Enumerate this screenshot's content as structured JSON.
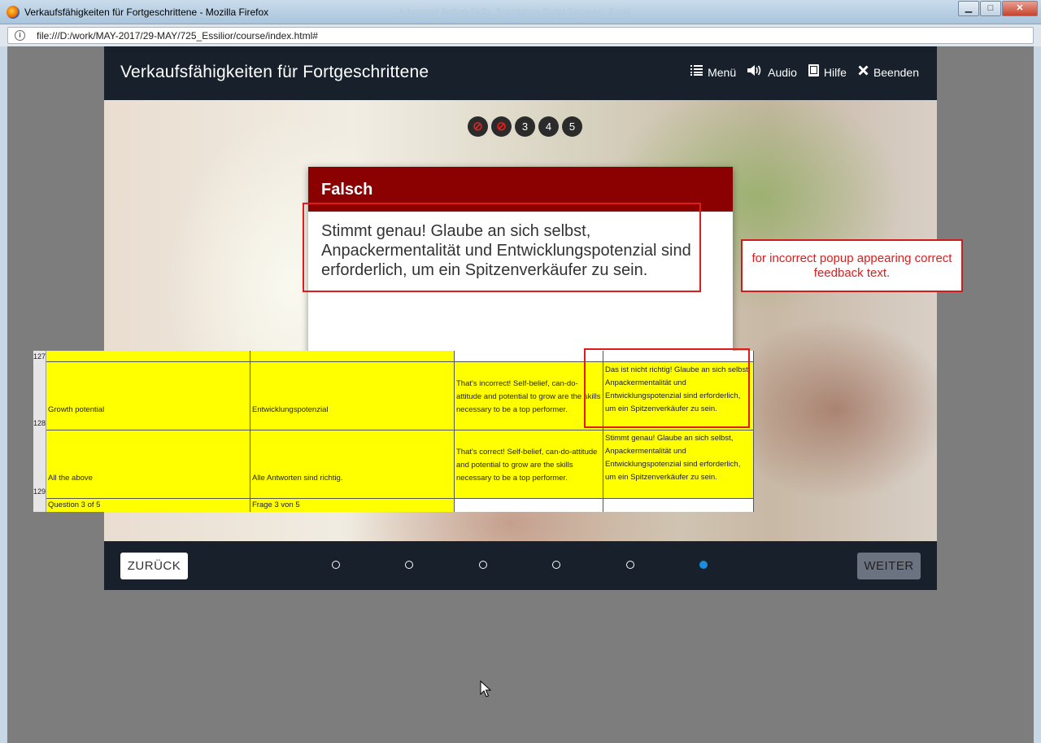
{
  "window": {
    "title": "Verkaufsfähigkeiten für Fortgeschrittene - Mozilla Firefox",
    "ghost_title": "Advanced Selling Skills_Translation Script Seminar - Excel",
    "url": "file:///D:/work/MAY-2017/29-MAY/725_Essilior/course/index.html#",
    "controls": {
      "minimize": "▁",
      "maximize": "□",
      "close": "✕"
    }
  },
  "header": {
    "title": "Verkaufsfähigkeiten für Fortgeschrittene",
    "menu": "Menü",
    "audio": "Audio",
    "help": "Hilfe",
    "exit": "Beenden"
  },
  "question_dots": [
    {
      "label": "⊘",
      "state": "done"
    },
    {
      "label": "⊘",
      "state": "done"
    },
    {
      "label": "3",
      "state": "current"
    },
    {
      "label": "4",
      "state": "open"
    },
    {
      "label": "5",
      "state": "open"
    }
  ],
  "popup": {
    "heading": "Falsch",
    "body": "Stimmt genau! Glaube an sich selbst, Anpackermentalität und Entwicklungspotenzial sind erforderlich, um ein Spitzenverkäufer zu sein."
  },
  "annotation": "for incorrect popup appearing correct feedback text.",
  "sheet": {
    "rows": [
      {
        "num": "127",
        "a": "",
        "b": "",
        "c": "",
        "d": ""
      },
      {
        "num": "128",
        "a": "Growth potential",
        "b": "Entwicklungspotenzial",
        "c": "That's incorrect! Self-belief, can-do-attitude and potential to grow are the skills necessary to be a top performer.",
        "d": "Das ist nicht richtig! Glaube an sich selbst, Anpackermentalität und Entwicklungspotenzial sind erforderlich, um ein Spitzenverkäufer zu sein."
      },
      {
        "num": "129",
        "a": "All the above",
        "b": "Alle Antworten sind richtig.",
        "c": "That's correct! Self-belief, can-do-attitude and potential to grow are the skills necessary to be a top performer.",
        "d": "Stimmt genau! Glaube an sich selbst, Anpackermentalität und Entwicklungspotenzial sind erforderlich, um ein Spitzenverkäufer zu sein."
      },
      {
        "num": "",
        "a": "Question 3 of 5",
        "b": "Frage 3 von 5",
        "c": "",
        "d": ""
      }
    ],
    "highlight_color": "#ffff00"
  },
  "footer": {
    "back": "ZURÜCK",
    "next": "WEITER",
    "pages": 6,
    "active_page": 6
  },
  "colors": {
    "header_bg": "#17202b",
    "popup_head": "#8b0000",
    "annotation": "#e11b1b",
    "active_dot": "#1a8ddf"
  }
}
